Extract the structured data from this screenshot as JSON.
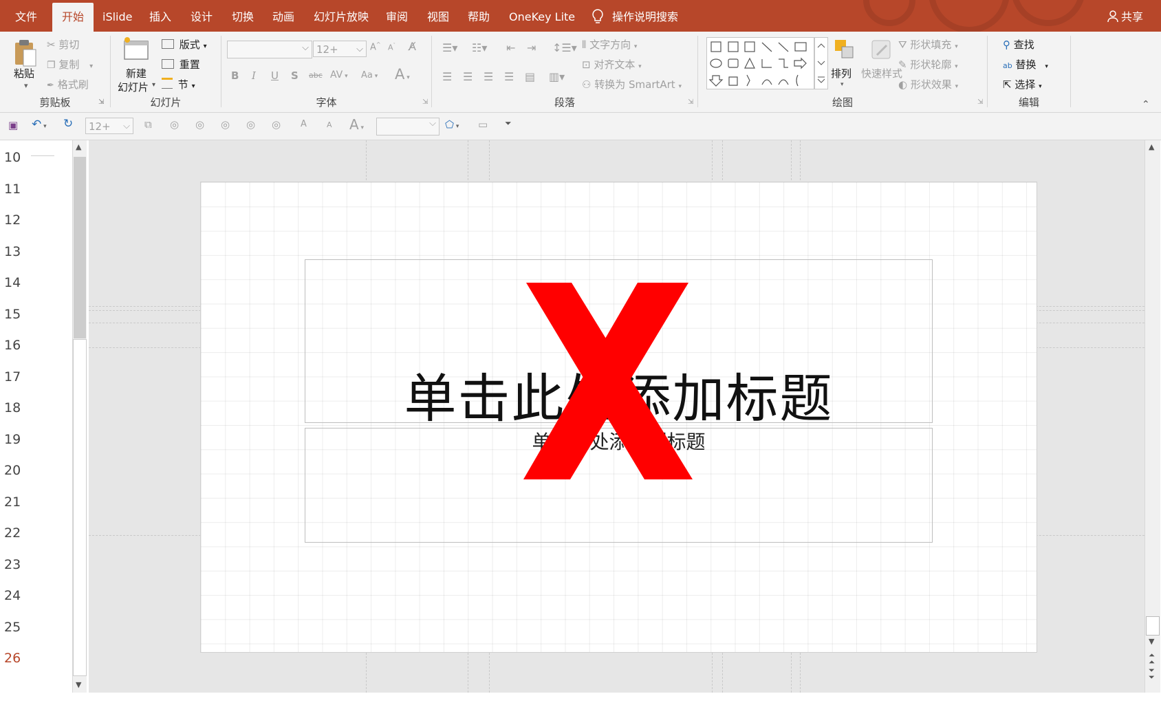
{
  "menu": {
    "tabs": [
      "文件",
      "开始",
      "iSlide",
      "插入",
      "设计",
      "切换",
      "动画",
      "幻灯片放映",
      "审阅",
      "视图",
      "帮助",
      "OneKey Lite"
    ],
    "active_tab": "开始",
    "search": "操作说明搜索",
    "share": "共享"
  },
  "ribbon": {
    "clipboard": {
      "paste": "粘贴",
      "cut": "剪切",
      "copy": "复制",
      "format_painter": "格式刷",
      "label": "剪贴板"
    },
    "slides": {
      "new_slide_line1": "新建",
      "new_slide_line2": "幻灯片",
      "layout": "版式",
      "reset": "重置",
      "section": "节",
      "label": "幻灯片"
    },
    "font": {
      "size": "12+",
      "bold": "B",
      "italic": "I",
      "underline": "U",
      "shadow": "S",
      "strike": "abc",
      "spacing": "AV",
      "case": "Aa",
      "label": "字体"
    },
    "paragraph": {
      "text_direction": "文字方向",
      "align_text": "对齐文本",
      "smartart": "转换为 SmartArt",
      "label": "段落"
    },
    "drawing": {
      "arrange": "排列",
      "quick_styles": "快速样式",
      "shape_fill": "形状填充",
      "shape_outline": "形状轮廓",
      "shape_effects": "形状效果",
      "label": "绘图"
    },
    "editing": {
      "find": "查找",
      "replace": "替换",
      "select": "选择",
      "label": "编辑"
    }
  },
  "qat": {
    "font_size": "12+"
  },
  "line_numbers": [
    "10",
    "11",
    "12",
    "13",
    "14",
    "15",
    "16",
    "17",
    "18",
    "19",
    "20",
    "21",
    "22",
    "23",
    "24",
    "25",
    "26"
  ],
  "current_line": "26",
  "slide": {
    "title_placeholder": "单击此处添加标题",
    "subtitle_placeholder": "单击此处添加副标题"
  },
  "colors": {
    "accent": "#b7472a",
    "cross_mark": "#ff0000"
  }
}
